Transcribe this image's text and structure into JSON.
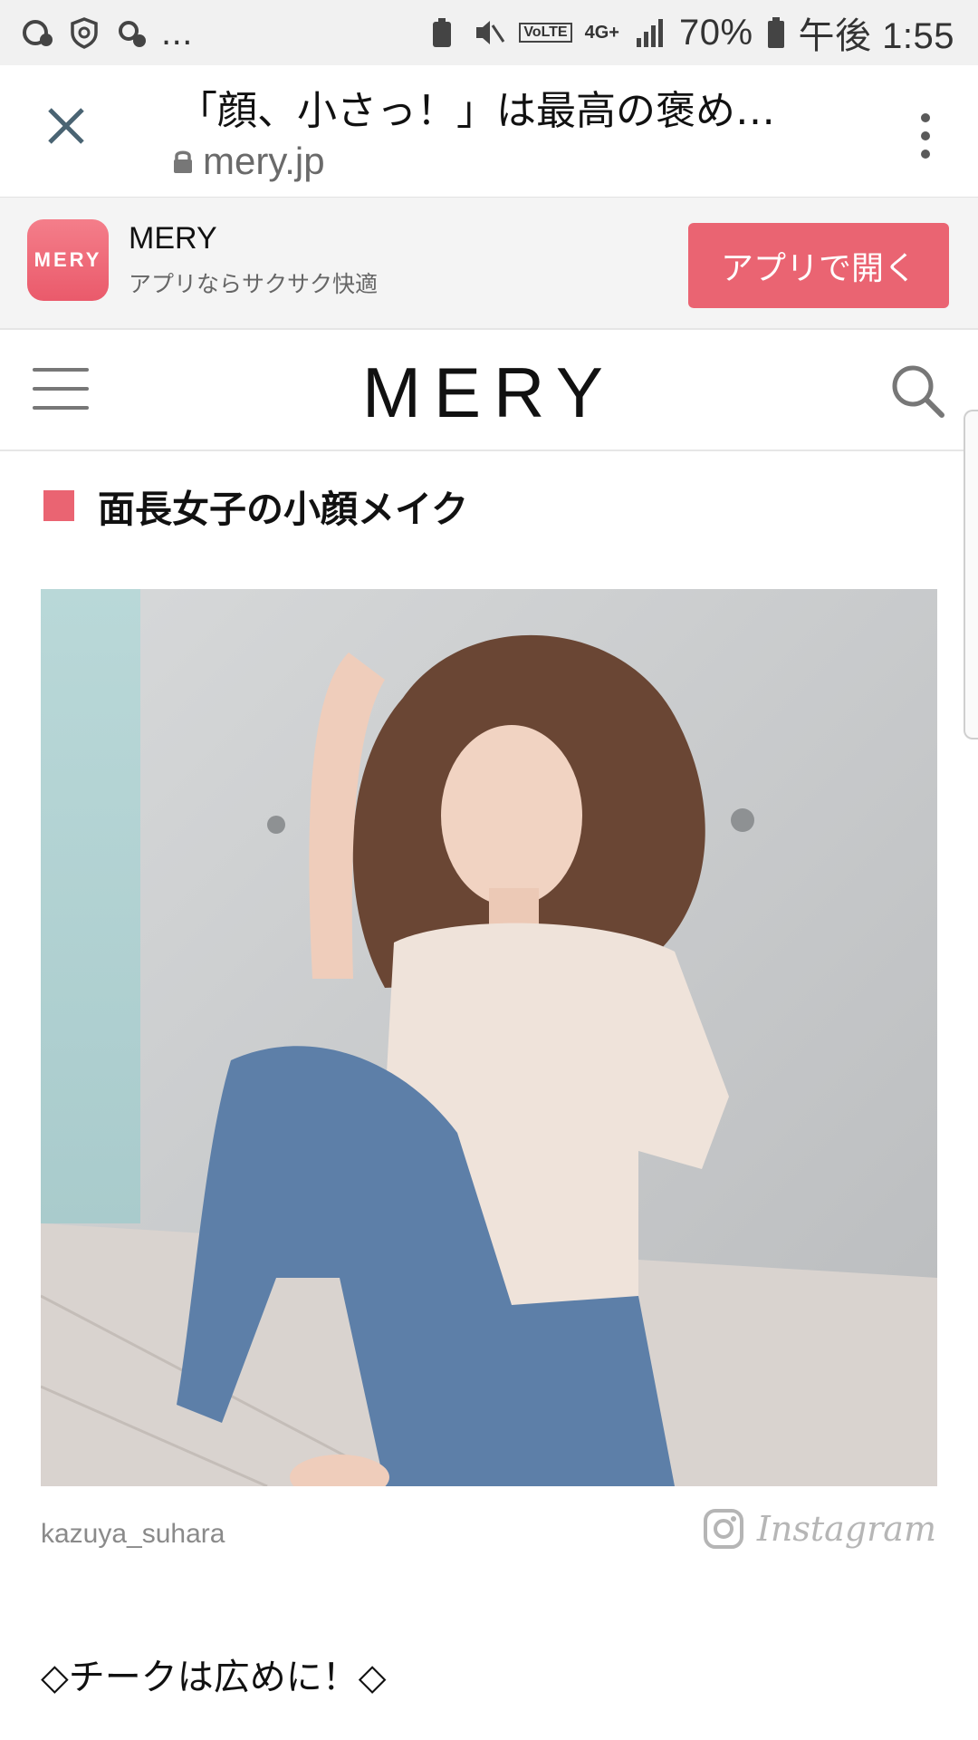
{
  "status_bar": {
    "more": "...",
    "network": "4G+",
    "volte": "VoLTE",
    "battery": "70%",
    "time": "午後 1:55"
  },
  "custom_tab": {
    "title": "「顔、小さっ！」は最高の褒め…",
    "url": "mery.jp"
  },
  "app_banner": {
    "icon_text": "MERY",
    "name": "MERY",
    "subtitle": "アプリならサクサク快適",
    "open_button": "アプリで開く"
  },
  "site_header": {
    "logo": "MERY"
  },
  "article": {
    "section_title": "面長女子の小顔メイク",
    "photo_credit": "kazuya_suhara",
    "source_label": "Instagram",
    "subheading": "◇チークは広めに！◇"
  },
  "colors": {
    "accent": "#ea6472",
    "status_bar_bg": "#f1f1f1",
    "banner_bg": "#f4f4f4"
  }
}
